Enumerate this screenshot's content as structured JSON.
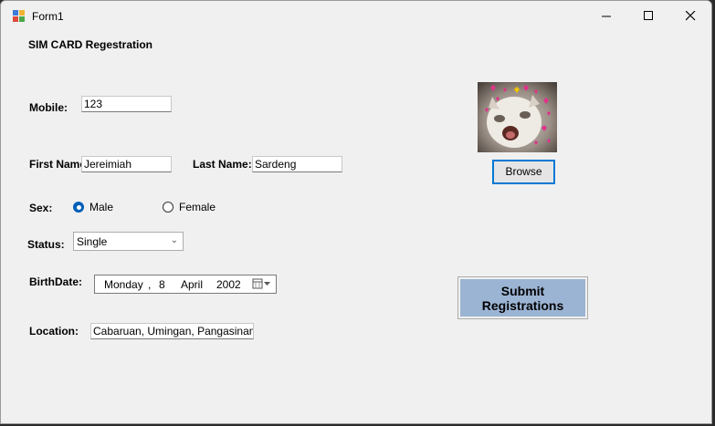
{
  "window": {
    "title": "Form1"
  },
  "form": {
    "heading": "SIM CARD Regestration",
    "mobile": {
      "label": "Mobile:",
      "value": "123"
    },
    "first_name": {
      "label": "First Name",
      "value": "Jereimiah"
    },
    "last_name": {
      "label": "Last Name:",
      "value": "Sardeng"
    },
    "sex": {
      "label": "Sex:",
      "options": [
        "Male",
        "Female"
      ],
      "selected": "Male"
    },
    "status": {
      "label": "Status:",
      "value": "Single"
    },
    "birthdate": {
      "label": "BirthDate:",
      "day_name": "Monday",
      "sep": ",",
      "day": "8",
      "month": "April",
      "year": "2002"
    },
    "location": {
      "label": "Location:",
      "value": "Cabaruan, Umingan, Pangasinan"
    },
    "browse_label": "Browse",
    "submit_line1": "Submit",
    "submit_line2": "Registrations",
    "photo": "cat-photo"
  },
  "colors": {
    "submit_bg": "#9cb4d4",
    "accent": "#005fb8",
    "window_bg": "#f0f0f0"
  },
  "icons": {
    "window_icon": "form-icon",
    "minimize": "minimize-icon",
    "maximize": "maximize-icon",
    "close": "close-icon",
    "dropdown": "chevron-down-icon",
    "calendar": "calendar-icon"
  }
}
